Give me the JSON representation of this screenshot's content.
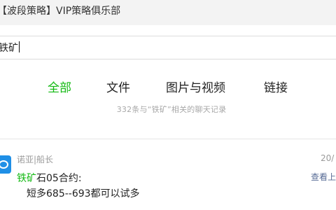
{
  "window": {
    "title": "【波段策略】VIP策略俱乐部"
  },
  "search": {
    "query": "铁矿"
  },
  "tabs": [
    {
      "label": "全部",
      "active": true
    },
    {
      "label": "文件",
      "active": false
    },
    {
      "label": "图片与视频",
      "active": false
    },
    {
      "label": "链接",
      "active": false
    }
  ],
  "summary": "332条与“铁矿”相关的聊天记录",
  "results": [
    {
      "sender": "诺亚|船长",
      "time": "20/",
      "view_context": "查看上",
      "highlight": "铁矿",
      "text_after_highlight": "石05合约:",
      "line2": "短多685--693都可以试多",
      "avatar_icon": "chat-avatar-icon"
    }
  ],
  "colors": {
    "accent_green": "#12b912",
    "link_blue": "#576b95",
    "muted_gray": "#a8a8a8",
    "avatar_blue": "#1f8fe6"
  }
}
